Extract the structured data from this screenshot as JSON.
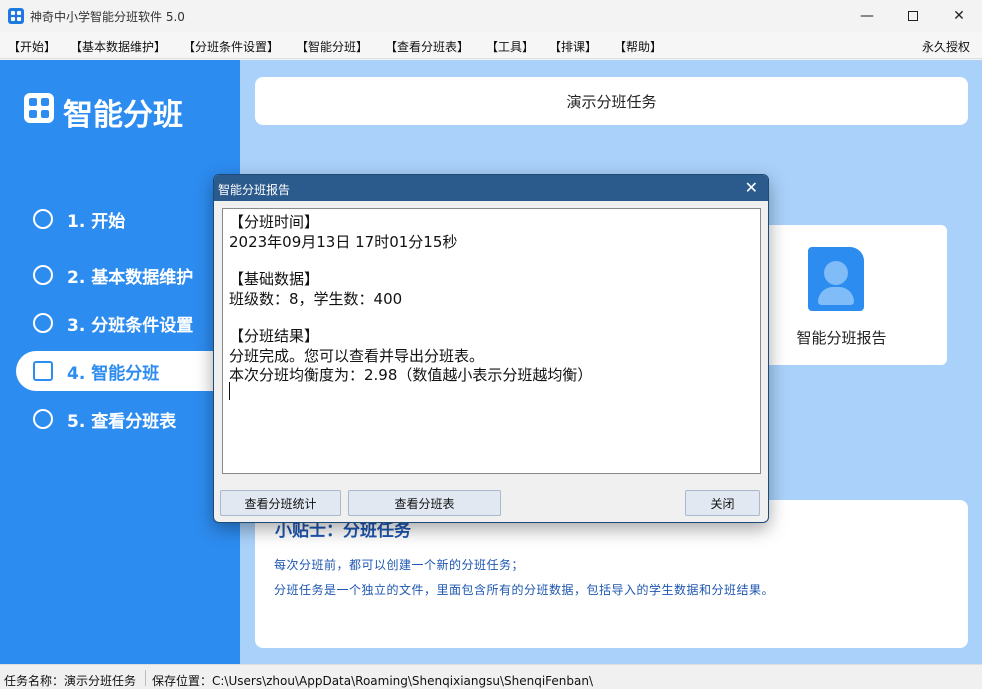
{
  "window": {
    "title": "神奇中小学智能分班软件 5.0"
  },
  "menu": {
    "items": [
      "【开始】",
      "【基本数据维护】",
      "【分班条件设置】",
      "【智能分班】",
      "【查看分班表】",
      "【工具】",
      "【排课】",
      "【帮助】"
    ],
    "license": "永久授权"
  },
  "sidebar": {
    "brand": "智能分班",
    "items": [
      {
        "label": "1. 开始",
        "icon": "play-icon"
      },
      {
        "label": "2. 基本数据维护",
        "icon": "info-icon"
      },
      {
        "label": "3. 分班条件设置",
        "icon": "gear-icon"
      },
      {
        "label": "4. 智能分班",
        "icon": "grid-icon",
        "active": true
      },
      {
        "label": "5. 查看分班表",
        "icon": "search-list-icon"
      }
    ]
  },
  "main": {
    "task_name": "演示分班任务",
    "report_card": {
      "label": "智能分班报告"
    },
    "tips": {
      "title": "小贴士：分班任务",
      "lines": [
        "每次分班前，都可以创建一个新的分班任务；",
        "分班任务是一个独立的文件，里面包含所有的分班数据，包括导入的学生数据和分班结果。"
      ]
    }
  },
  "dialog": {
    "title": "智能分班报告",
    "lines": [
      "【分班时间】",
      "2023年09月13日 17时01分15秒",
      "",
      "【基础数据】",
      "班级数：8，学生数：400",
      "",
      "【分班结果】",
      "分班完成。您可以查看并导出分班表。",
      "本次分班均衡度为：2.98（数值越小表示分班越均衡）"
    ],
    "buttons": {
      "stats": "查看分班统计",
      "table": "查看分班表",
      "close": "关闭"
    }
  },
  "status": {
    "task_label": "任务名称：演示分班任务",
    "path_label": "保存位置：C:\\Users\\zhou\\AppData\\Roaming\\Shenqixiangsu\\ShenqiFenban\\"
  },
  "colors": {
    "accent": "#2d8cf0",
    "main_bg": "#a9d1fa",
    "dialog_title": "#2b5b8c",
    "tips_text": "#1e56b0"
  }
}
